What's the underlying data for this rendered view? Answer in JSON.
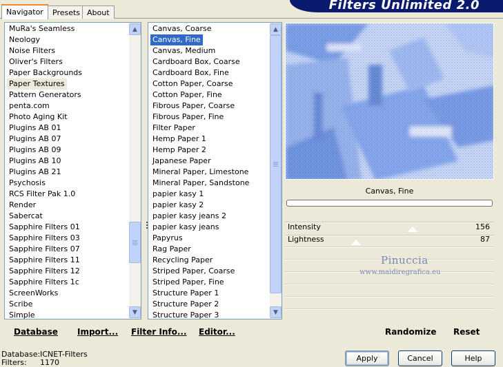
{
  "tabs": [
    {
      "label": "Navigator",
      "active": true
    },
    {
      "label": "Presets",
      "active": false
    },
    {
      "label": "About",
      "active": false
    }
  ],
  "banner": {
    "title": "Filters Unlimited 2.0"
  },
  "categories": {
    "items": [
      "MuRa's Seamless",
      "Neology",
      "Noise Filters",
      "Oliver's Filters",
      "Paper Backgrounds",
      "Paper Textures",
      "Pattern Generators",
      "penta.com",
      "Photo Aging Kit",
      "Plugins AB 01",
      "Plugins AB 07",
      "Plugins AB 09",
      "Plugins AB 10",
      "Plugins AB 21",
      "Psychosis",
      "RCS Filter Pak 1.0",
      "Render",
      "Sabercat",
      "Sapphire Filters 01",
      "Sapphire Filters 03",
      "Sapphire Filters 07",
      "Sapphire Filters 11",
      "Sapphire Filters 12",
      "Sapphire Filters 1c",
      "ScreenWorks",
      "Scribe",
      "Simple"
    ],
    "selected": "Paper Textures"
  },
  "filters": {
    "items": [
      "Canvas, Coarse",
      "Canvas, Fine",
      "Canvas, Medium",
      "Cardboard Box, Coarse",
      "Cardboard Box, Fine",
      "Cotton Paper, Coarse",
      "Cotton Paper, Fine",
      "Fibrous Paper, Coarse",
      "Fibrous Paper, Fine",
      "Filter Paper",
      "Hemp Paper 1",
      "Hemp Paper 2",
      "Japanese Paper",
      "Mineral Paper, Limestone",
      "Mineral Paper, Sandstone",
      "papier kasy 1",
      "papier kasy 2",
      "papier kasy jeans 2",
      "papier kasy jeans",
      "Papyrus",
      "Rag Paper",
      "Recycling Paper",
      "Striped Paper, Coarse",
      "Striped Paper, Fine",
      "Structure Paper 1",
      "Structure Paper 2",
      "Structure Paper 3"
    ],
    "selected": "Canvas, Fine"
  },
  "toolbar": {
    "database": "Database",
    "import": "Import...",
    "filter_info": "Filter Info...",
    "editor": "Editor...",
    "randomize": "Randomize",
    "reset": "Reset"
  },
  "preview": {
    "caption": "Canvas, Fine",
    "accent_color": "#2f5fd0"
  },
  "params": [
    {
      "label": "Intensity",
      "value": "156",
      "level": 0.61
    },
    {
      "label": "Lightness",
      "value": "87",
      "level": 0.34
    }
  ],
  "watermark": {
    "line1": "Pinuccia",
    "line2": "www.maidiregrafica.eu"
  },
  "status": {
    "database_label": "Database:",
    "database_value": "ICNET-Filters",
    "filters_label": "Filters:",
    "filters_value": "1170"
  },
  "buttons": {
    "apply": "Apply",
    "cancel": "Cancel",
    "help": "Help"
  }
}
